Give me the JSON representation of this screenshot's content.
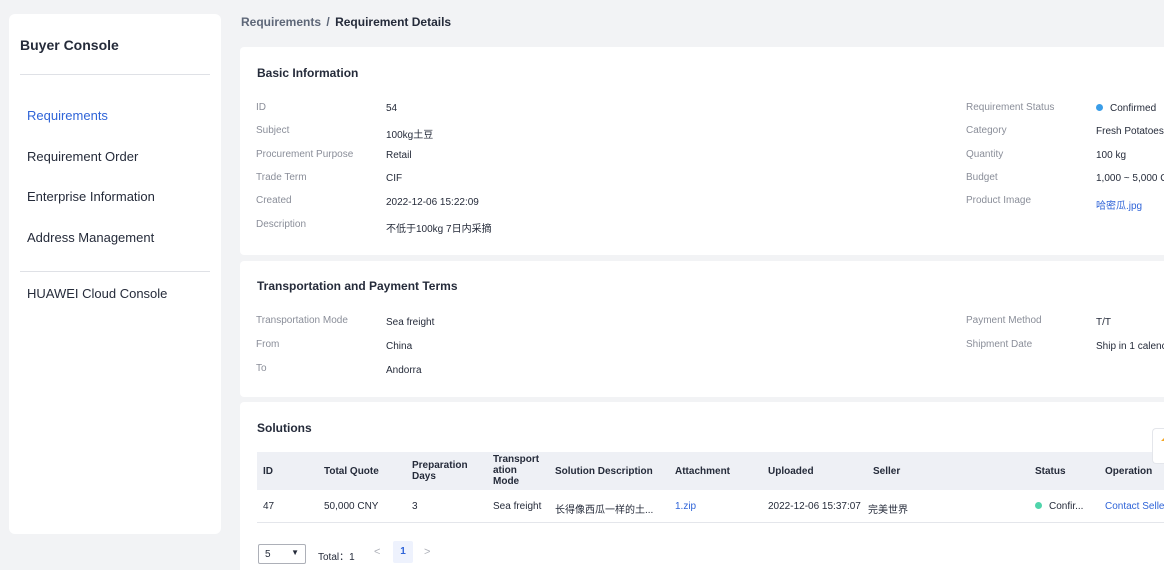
{
  "sidebar": {
    "title": "Buyer Console",
    "items": [
      {
        "label": "Requirements"
      },
      {
        "label": "Requirement Order"
      },
      {
        "label": "Enterprise Information"
      },
      {
        "label": "Address Management"
      }
    ],
    "external": {
      "label": "HUAWEI Cloud Console"
    }
  },
  "breadcrumb": {
    "parent": "Requirements",
    "separator": "/",
    "current": "Requirement Details"
  },
  "basic": {
    "title": "Basic Information",
    "left": [
      {
        "label": "ID",
        "value": "54"
      },
      {
        "label": "Subject",
        "value": "100kg土豆"
      },
      {
        "label": "Procurement Purpose",
        "value": "Retail"
      },
      {
        "label": "Trade Term",
        "value": "CIF"
      },
      {
        "label": "Created",
        "value": "2022-12-06 15:22:09"
      },
      {
        "label": "Description",
        "value": "不低于100kg 7日内采摘"
      }
    ],
    "right": [
      {
        "label": "Requirement Status",
        "value": "Confirmed"
      },
      {
        "label": "Category",
        "value": "Fresh Potatoes"
      },
      {
        "label": "Quantity",
        "value": "100 kg"
      },
      {
        "label": "Budget",
        "value": "1,000 ~ 5,000 C"
      },
      {
        "label": "Product Image",
        "value": "哈密瓜.jpg"
      }
    ],
    "status_color": "#3a9de8"
  },
  "transport": {
    "title": "Transportation and Payment Terms",
    "left": [
      {
        "label": "Transportation Mode",
        "value": "Sea freight"
      },
      {
        "label": "From",
        "value": "China"
      },
      {
        "label": "To",
        "value": "Andorra"
      }
    ],
    "right": [
      {
        "label": "Payment Method",
        "value": "T/T"
      },
      {
        "label": "Shipment Date",
        "value": "Ship in 1 calenc"
      }
    ]
  },
  "solutions": {
    "title": "Solutions",
    "columns": [
      "ID",
      "Total Quote",
      "Preparation Days",
      "Transportation Mode",
      "Solution Description",
      "Attachment",
      "Uploaded",
      "Seller",
      "Status",
      "Operation"
    ],
    "column_display": {
      "transport": "Transport ation Mode"
    },
    "rows": [
      {
        "id": "47",
        "total_quote": "50,000 CNY",
        "prep_days": "3",
        "transport_mode": "Sea freight",
        "description": "长得像西瓜一样的土...",
        "attachment": "1.zip",
        "uploaded": "2022-12-06 15:37:07",
        "seller": "完美世界",
        "status": "Confir...",
        "operation": "Contact Selle"
      }
    ],
    "status_color": "#50d4ab"
  },
  "pager": {
    "size": "5",
    "total": "Total：1",
    "page": "1",
    "prev": "<",
    "next": ">"
  },
  "icons": {
    "dropdown": "chevron-down-icon",
    "float": "feedback-icon"
  }
}
